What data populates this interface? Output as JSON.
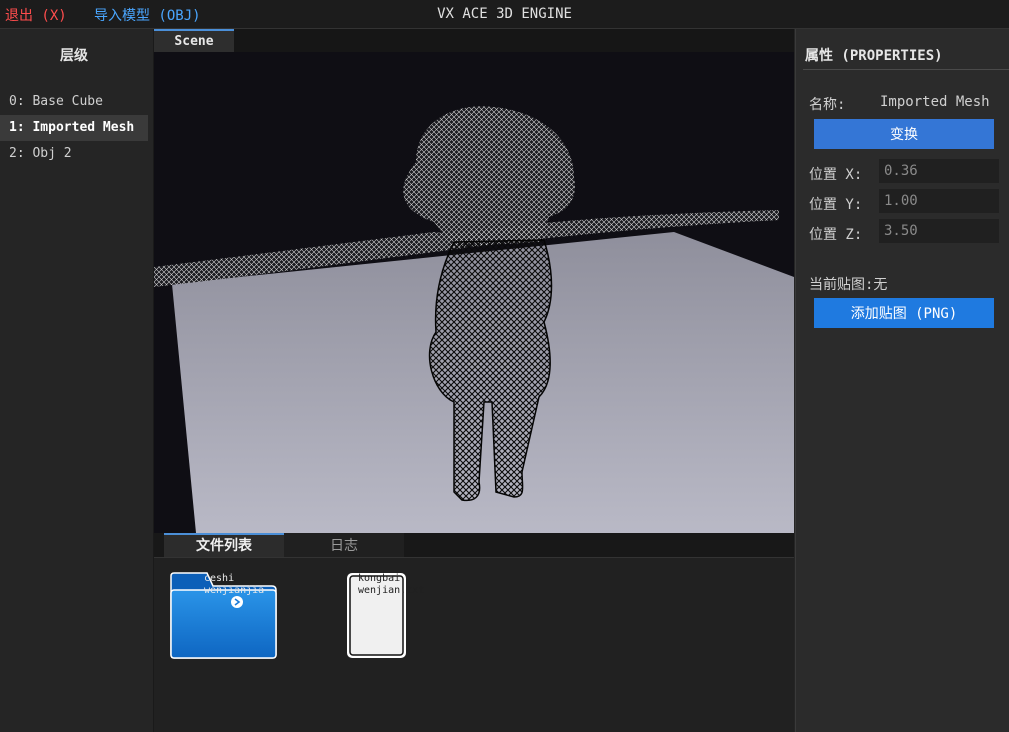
{
  "topbar": {
    "exit_label": "退出 (X)",
    "import_label": "导入模型 (OBJ)",
    "title": "VX ACE 3D ENGINE",
    "exit_color": "#ff4d4d",
    "import_color": "#4aa6ff"
  },
  "hierarchy": {
    "title": "层级",
    "items": [
      {
        "label": "0: Base Cube",
        "selected": false
      },
      {
        "label": "1: Imported Mesh",
        "selected": true
      },
      {
        "label": "2: Obj 2",
        "selected": false
      }
    ]
  },
  "scene": {
    "tab_label": "Scene"
  },
  "bottom": {
    "tabs": [
      {
        "label": "文件列表",
        "active": true
      },
      {
        "label": "日志",
        "active": false
      }
    ],
    "files": [
      {
        "name": "ceshi\nwenjianjia",
        "type": "folder",
        "icon": "folder-icon"
      },
      {
        "name": "kongbai\nwenjian.txt",
        "type": "file",
        "icon": "text-file-icon"
      }
    ]
  },
  "properties": {
    "title": "属性 (PROPERTIES)",
    "name_label": "名称:",
    "name_value": "Imported Mesh",
    "transform_button": "变换",
    "pos_x_label": "位置 X:",
    "pos_x_value": "0.36",
    "pos_y_label": "位置 Y:",
    "pos_y_value": "1.00",
    "pos_z_label": "位置 Z:",
    "pos_z_value": "3.50",
    "texture_label": "当前贴图:无",
    "add_texture_button": "添加贴图 (PNG)",
    "accent_color": "#3476d6"
  }
}
